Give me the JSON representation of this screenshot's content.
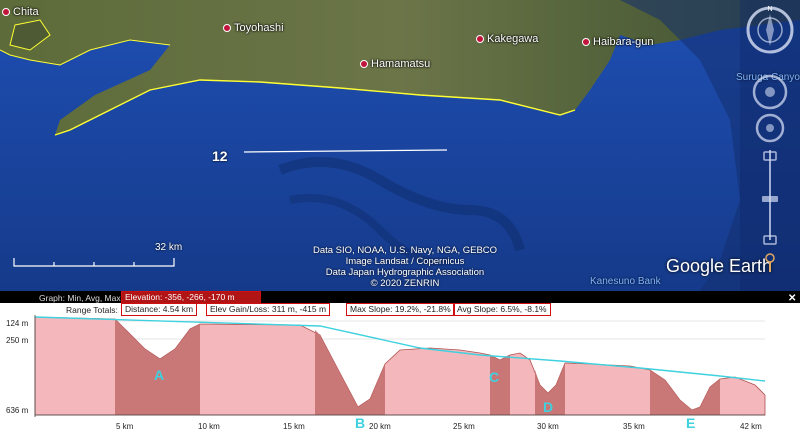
{
  "map": {
    "places": {
      "chita": "Chita",
      "toyohashi": "Toyohashi",
      "hamamatsu": "Hamamatsu",
      "kakegawa": "Kakegawa",
      "haibara": "Haibara-gun"
    },
    "seas": {
      "suruga": "Suruga Canyon",
      "kanesuno": "Kanesuno Bank"
    },
    "path_label": "12",
    "scale_label": "32 km",
    "attribution": [
      "Data SIO, NOAA, U.S. Navy, NGA, GEBCO",
      "Image Landsat / Copernicus",
      "Data Japan Hydrographic Association",
      "© 2020 ZENRIN"
    ],
    "logo": "Google Earth",
    "compass_label": "N"
  },
  "profile": {
    "graph_label": "Graph:",
    "graph_modes": "Min, Avg, Max",
    "elevation": "Elevation: -356, -266, -170 m",
    "range_totals": "Range Totals:",
    "distance": "Distance: 4.54 km",
    "elev_gain_loss": "Elev Gain/Loss: 311 m, -415 m",
    "max_slope": "Max Slope: 19.2%, -21.8%",
    "avg_slope": "Avg Slope: 6.5%, -8.1%",
    "close": "✕",
    "y_labels": [
      "124 m",
      "250 m",
      "636 m"
    ],
    "x_labels": [
      "5 km",
      "10 km",
      "15 km",
      "20 km",
      "25 km",
      "30 km",
      "35 km",
      "42 km"
    ],
    "markers": [
      "A",
      "B",
      "C",
      "D",
      "E"
    ]
  },
  "colors": {
    "profile_fill": "#f4b8bc",
    "selected_fill": "#c4706f",
    "trend_line": "#3ed1df",
    "accent_red": "#d01010"
  }
}
